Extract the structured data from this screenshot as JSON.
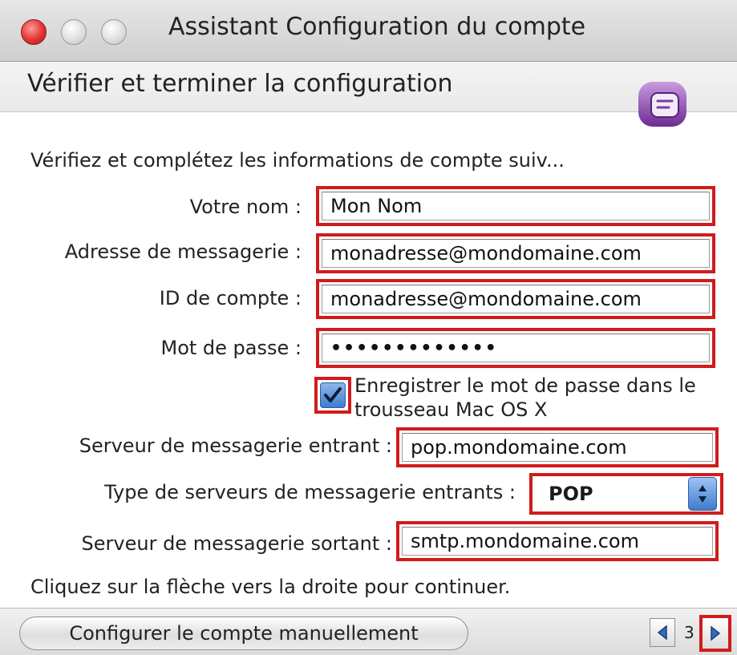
{
  "window": {
    "title": "Assistant Configuration du compte"
  },
  "header": {
    "title": "Vérifier et terminer la configuration"
  },
  "instruction": "Vérifiez et complétez les informations de compte suiv...",
  "form": {
    "name_label": "Votre nom :",
    "name_value": "Mon Nom",
    "email_label": "Adresse de messagerie :",
    "email_value": "monadresse@mondomaine.com",
    "account_id_label": "ID de compte :",
    "account_id_value": "monadresse@mondomaine.com",
    "password_label": "Mot de passe :",
    "password_value": "•••••••••••••",
    "save_password_label": "Enregistrer le mot de passe dans le trousseau Mac OS X",
    "save_password_checked": true,
    "incoming_server_label": "Serveur de messagerie entrant :",
    "incoming_server_value": "pop.mondomaine.com",
    "incoming_type_label": "Type de serveurs de messagerie entrants :",
    "incoming_type_value": "POP",
    "outgoing_server_label": "Serveur de messagerie sortant :",
    "outgoing_server_value": "smtp.mondomaine.com"
  },
  "footer": {
    "continue_hint": "Cliquez sur la flèche vers la droite pour continuer.",
    "manual_button": "Configurer le compte manuellement",
    "page_number": "3"
  },
  "colors": {
    "highlight": "#d11b1b",
    "accent": "#3f7bcf",
    "app_icon": "#8a3fae"
  },
  "icons": [
    "close-button-icon",
    "minimize-button-icon",
    "zoom-button-icon",
    "entourage-app-icon",
    "checkmark-icon",
    "updown-arrows-icon",
    "arrow-left-icon",
    "arrow-right-icon"
  ]
}
